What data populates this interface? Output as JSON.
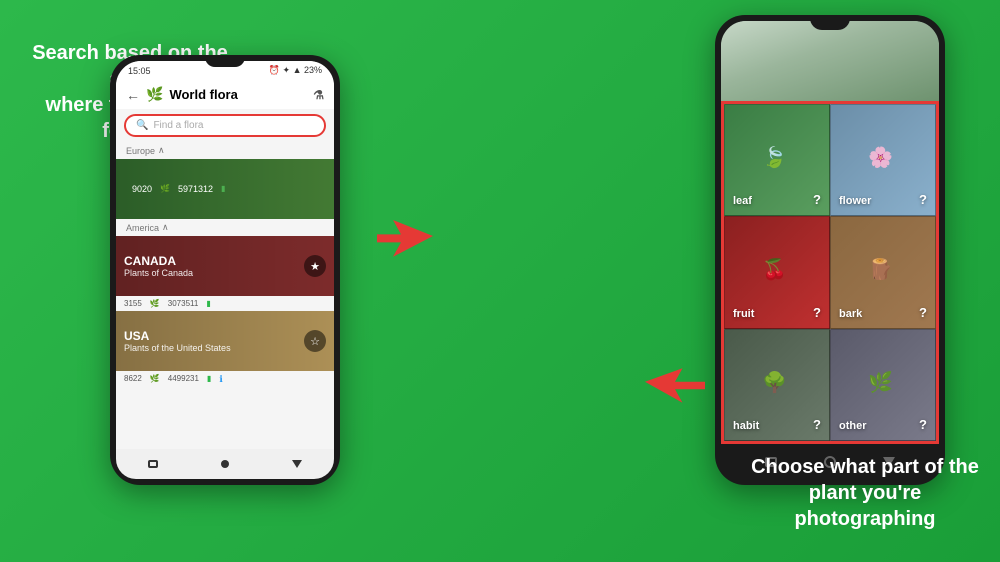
{
  "background": "#2db84b",
  "left_heading": {
    "line1": "Search based on the area",
    "line2": "where the plant is found"
  },
  "right_heading": {
    "line1": "Choose what part of the",
    "line2": "plant you're photographing"
  },
  "phone1": {
    "status_time": "15:05",
    "status_icons": "⏰ ✦ ▲ 23%",
    "title": "World flora",
    "search_placeholder": "Find a flora",
    "section_europe": "Europe",
    "europe_stats1": "9020",
    "europe_stats2": "5971312",
    "section_america": "America",
    "canada_name": "CANADA",
    "canada_sub": "Plants of Canada",
    "canada_stats1": "3155",
    "canada_stats2": "3073511",
    "usa_name": "USA",
    "usa_sub": "Plants of the United States",
    "usa_stats1": "8622",
    "usa_stats2": "4499231"
  },
  "phone2": {
    "grid": [
      {
        "id": "leaf",
        "label": "leaf",
        "icon": "🍃"
      },
      {
        "id": "flower",
        "label": "flower",
        "icon": "🌸"
      },
      {
        "id": "fruit",
        "label": "fruit",
        "icon": "🍒"
      },
      {
        "id": "bark",
        "label": "bark",
        "icon": "🪵"
      },
      {
        "id": "habit",
        "label": "habit",
        "icon": "🌳"
      },
      {
        "id": "other",
        "label": "other",
        "icon": "🌿"
      }
    ]
  },
  "icons": {
    "back": "←",
    "leaf_brand": "🌿",
    "filter": "⚗",
    "search": "🔍",
    "chevron": "∧",
    "star_filled": "★",
    "star_outline": "☆",
    "info": "ℹ"
  }
}
